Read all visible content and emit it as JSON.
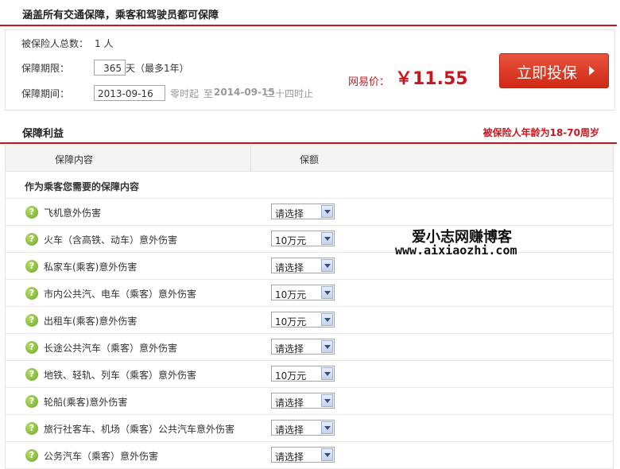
{
  "header": {
    "title": "涵盖所有交通保障，乘客和驾驶员都可保障"
  },
  "info": {
    "insured_count_label": "被保险人总数：",
    "insured_count_value": "1 人",
    "term_label": "保障期限：",
    "term_value": "365",
    "term_suffix": "天（最多1年）",
    "period_label": "保障期间：",
    "start_date": "2013-09-16",
    "start_suffix": "零时起",
    "end_prefix": "至",
    "end_date": "2014-09-15",
    "end_suffix": "二十四时止"
  },
  "price": {
    "label": "网易价：",
    "value": "￥11.55"
  },
  "buy_button": {
    "label": "立即投保"
  },
  "benefits": {
    "title": "保障利益",
    "age_note": "被保险人年龄为18-70周岁",
    "col_content": "保障内容",
    "col_amount": "保额",
    "group_title": "作为乘客您需要的保障内容",
    "rows": [
      {
        "name": "飞机意外伤害",
        "amount": "请选择"
      },
      {
        "name": "火车（含高铁、动车）意外伤害",
        "amount": "10万元"
      },
      {
        "name": "私家车(乘客)意外伤害",
        "amount": "请选择"
      },
      {
        "name": "市内公共汽、电车（乘客）意外伤害",
        "amount": "10万元"
      },
      {
        "name": "出租车(乘客)意外伤害",
        "amount": "10万元"
      },
      {
        "name": "长途公共汽车（乘客）意外伤害",
        "amount": "请选择"
      },
      {
        "name": "地铁、轻轨、列车（乘客）意外伤害",
        "amount": "10万元"
      },
      {
        "name": "轮船(乘客)意外伤害",
        "amount": "请选择"
      },
      {
        "name": "旅行社客车、机场（乘客）公共汽车意外伤害",
        "amount": "请选择"
      },
      {
        "name": "公务汽车（乘客）意外伤害",
        "amount": "请选择"
      }
    ]
  },
  "watermark": {
    "line1": "爱小志网赚博客",
    "line2": "www.aixiaozhi.com"
  }
}
